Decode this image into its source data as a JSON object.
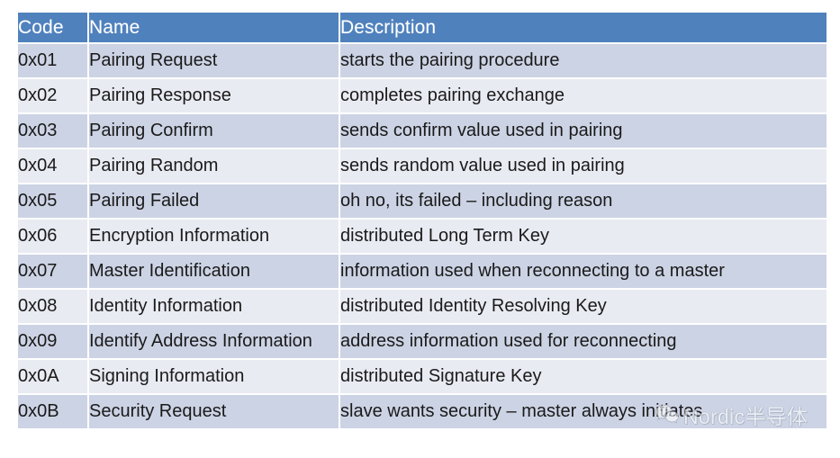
{
  "table": {
    "headers": [
      {
        "key": "code",
        "label": "Code"
      },
      {
        "key": "name",
        "label": "Name"
      },
      {
        "key": "description",
        "label": "Description"
      }
    ],
    "rows": [
      {
        "code": "0x01",
        "name": "Pairing Request",
        "description": "starts the pairing procedure"
      },
      {
        "code": "0x02",
        "name": "Pairing Response",
        "description": "completes pairing exchange"
      },
      {
        "code": "0x03",
        "name": "Pairing Confirm",
        "description": "sends confirm value used in pairing"
      },
      {
        "code": "0x04",
        "name": "Pairing Random",
        "description": "sends random value used in pairing"
      },
      {
        "code": "0x05",
        "name": "Pairing Failed",
        "description": "oh no, its failed – including reason"
      },
      {
        "code": "0x06",
        "name": "Encryption Information",
        "description": "distributed Long Term Key"
      },
      {
        "code": "0x07",
        "name": "Master Identification",
        "description": "information used when reconnecting to a master"
      },
      {
        "code": "0x08",
        "name": "Identity Information",
        "description": "distributed Identity Resolving Key"
      },
      {
        "code": "0x09",
        "name": "Identify Address Information",
        "description": "address information used for reconnecting"
      },
      {
        "code": "0x0A",
        "name": "Signing Information",
        "description": "distributed Signature Key"
      },
      {
        "code": "0x0B",
        "name": "Security Request",
        "description": "slave wants security – master always initiates"
      }
    ]
  },
  "watermark": {
    "icon": "wechat-icon",
    "text": "Nordic半导体"
  },
  "colors": {
    "header_background": "#4f81bd",
    "header_text": "#ffffff",
    "row_odd_background": "#ccd3e4",
    "row_even_background": "#e9ebf3",
    "body_text": "#1a1a1a",
    "page_background": "#ffffff"
  }
}
